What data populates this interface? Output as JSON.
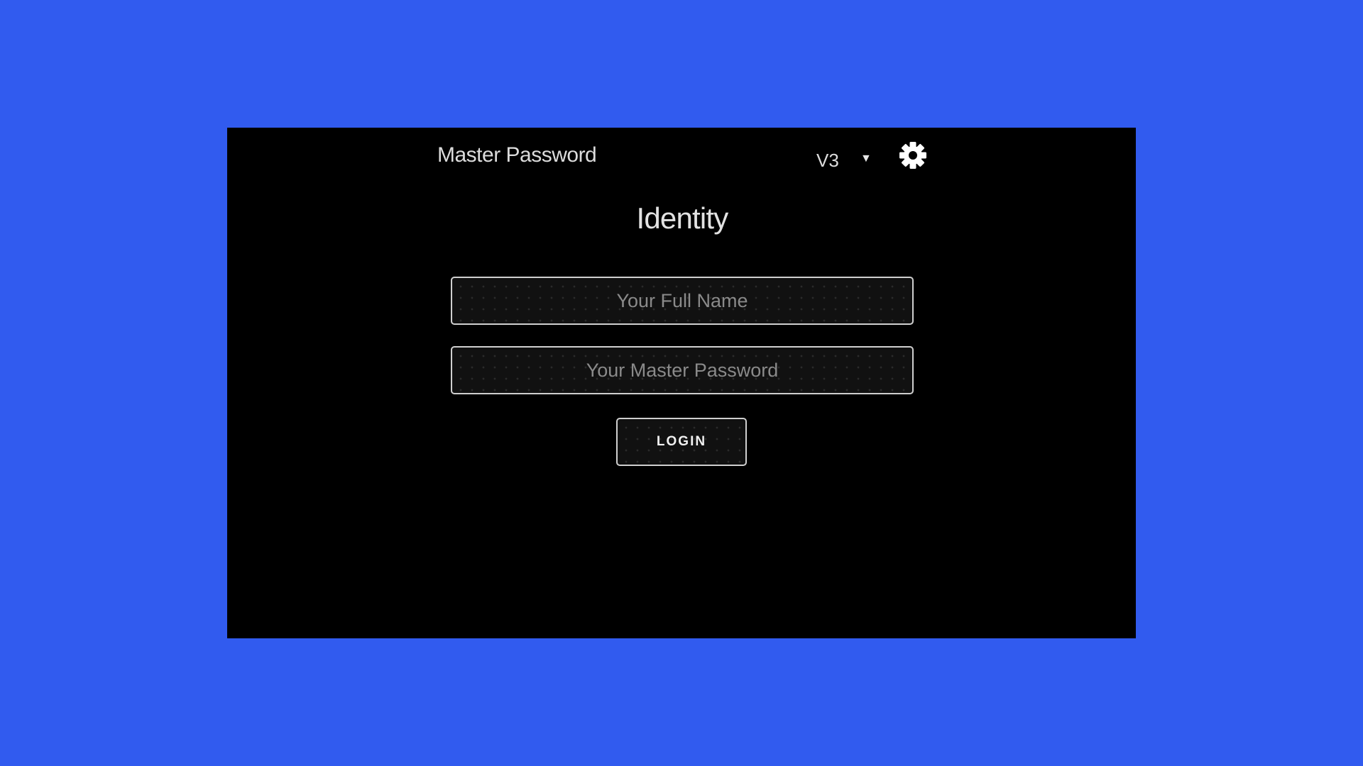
{
  "app": {
    "title": "Master Password",
    "background_color": "#315bef",
    "panel_color": "#000000"
  },
  "header": {
    "version_select": {
      "value": "V3",
      "caret": "▼"
    },
    "settings_icon": "gear-icon"
  },
  "main": {
    "title": "Identity",
    "name_field": {
      "placeholder": "Your Full Name",
      "value": ""
    },
    "password_field": {
      "placeholder": "Your Master Password",
      "value": ""
    },
    "login_label": "LOGIN"
  }
}
